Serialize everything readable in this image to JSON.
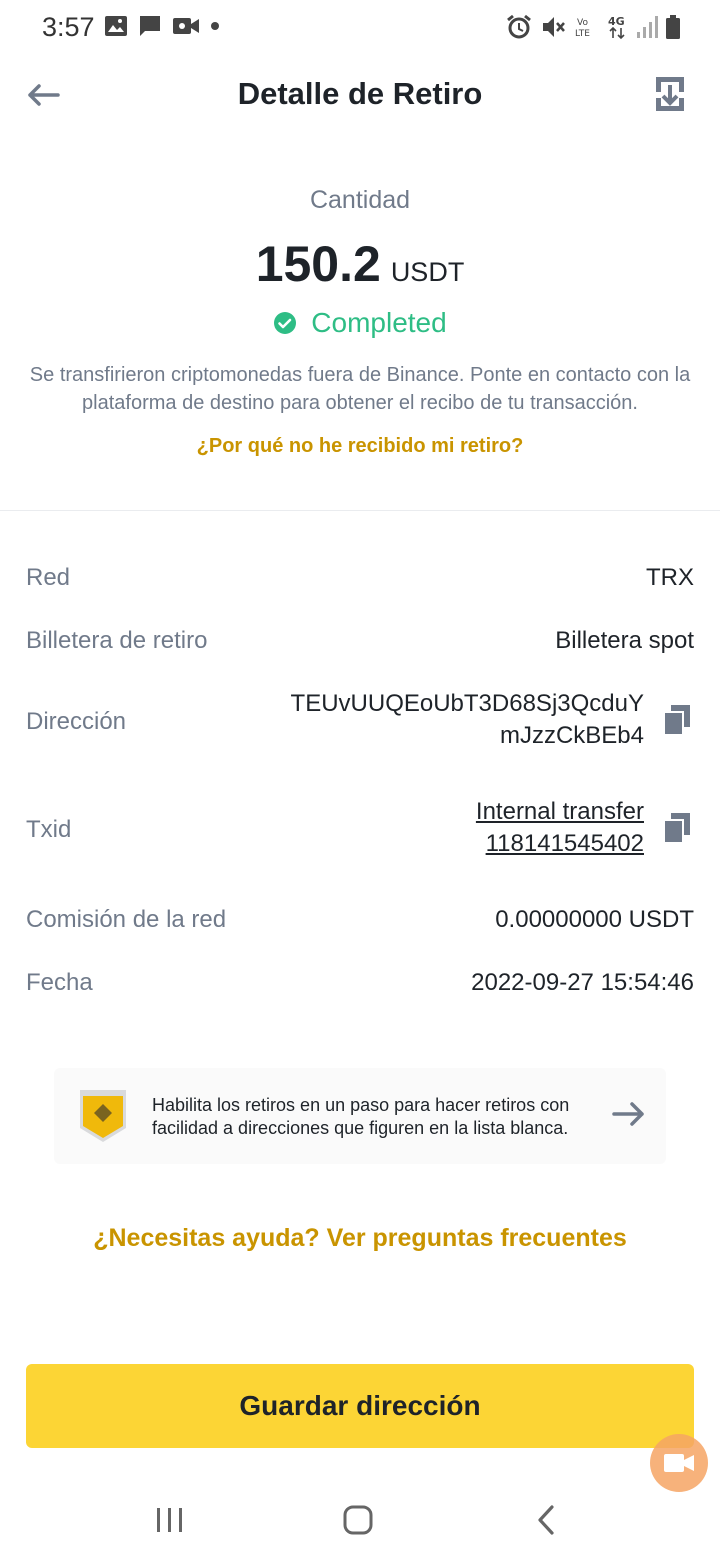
{
  "status_bar": {
    "time": "3:57",
    "left_icons": [
      "image-icon",
      "message-icon",
      "video-icon",
      "dot-icon"
    ],
    "right_icons": [
      "alarm-icon",
      "mute-icon",
      "volte-icon",
      "4g-icon",
      "signal-icon",
      "battery-icon"
    ],
    "volte_label": "Vo LTE",
    "network_label": "4G"
  },
  "header": {
    "title": "Detalle de Retiro",
    "back_icon": "arrow-left-icon",
    "export_icon": "export-icon"
  },
  "summary": {
    "amount_label": "Cantidad",
    "amount_value": "150.2",
    "amount_unit": "USDT",
    "status": "Completed",
    "status_color": "#2ebd85",
    "description": "Se transfirieron criptomonedas fuera de Binance. Ponte en contacto con la plataforma de destino para obtener el recibo de tu transacción.",
    "why_link": "¿Por qué no he recibido mi retiro?"
  },
  "details": {
    "network": {
      "label": "Red",
      "value": "TRX"
    },
    "wallet": {
      "label": "Billetera de retiro",
      "value": "Billetera spot"
    },
    "address": {
      "label": "Dirección",
      "line1": "TEUvUUQEoUbT3D68Sj3QcduY",
      "line2": "mJzzCkBEb4"
    },
    "txid": {
      "label": "Txid",
      "line1": "Internal transfer",
      "line2": "118141545402"
    },
    "fee": {
      "label": "Comisión de la red",
      "value": "0.00000000 USDT"
    },
    "date": {
      "label": "Fecha",
      "value": "2022-09-27 15:54:46"
    }
  },
  "banner": {
    "text": "Habilita los retiros en un paso para hacer retiros con facilidad a direcciones que figuren en la lista blanca.",
    "icon": "shield-icon",
    "arrow_icon": "arrow-right-icon"
  },
  "help_link": "¿Necesitas ayuda? Ver preguntas frecuentes",
  "primary_button": "Guardar dirección",
  "colors": {
    "accent": "#fcd535",
    "link": "#c99400",
    "muted": "#707a8a",
    "text": "#1e2329"
  },
  "nav_bar": {
    "icons": [
      "recent-apps-icon",
      "home-icon",
      "back-icon"
    ]
  }
}
